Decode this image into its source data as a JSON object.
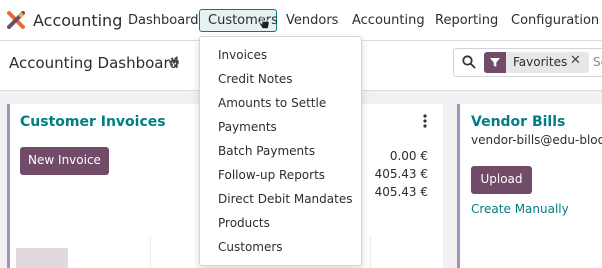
{
  "app": {
    "name": "Accounting"
  },
  "nav": {
    "items": [
      "Dashboard",
      "Customers",
      "Vendors",
      "Accounting",
      "Reporting",
      "Configuration"
    ],
    "active": "Customers"
  },
  "page": {
    "title": "Accounting Dashboard"
  },
  "search": {
    "facet_label": "Favorites",
    "facet_icon": "filter-icon",
    "placeholder_visible": "Se"
  },
  "customers_menu": {
    "items": [
      "Invoices",
      "Credit Notes",
      "Amounts to Settle",
      "Payments",
      "Batch Payments",
      "Follow-up Reports",
      "Direct Debit Mandates",
      "Products",
      "Customers"
    ]
  },
  "customer_invoices": {
    "title": "Customer Invoices",
    "button_label": "New Invoice",
    "amounts": [
      "0.00 €",
      "405.43 €",
      "405.43 €"
    ]
  },
  "vendor_bills": {
    "title": "Vendor Bills",
    "email": "vendor-bills@edu-bloom",
    "button_label": "Upload",
    "link_label": "Create Manually"
  },
  "colors": {
    "brand_primary": "#714b67",
    "accent_teal": "#017e84",
    "card_border": "#a590bd"
  }
}
